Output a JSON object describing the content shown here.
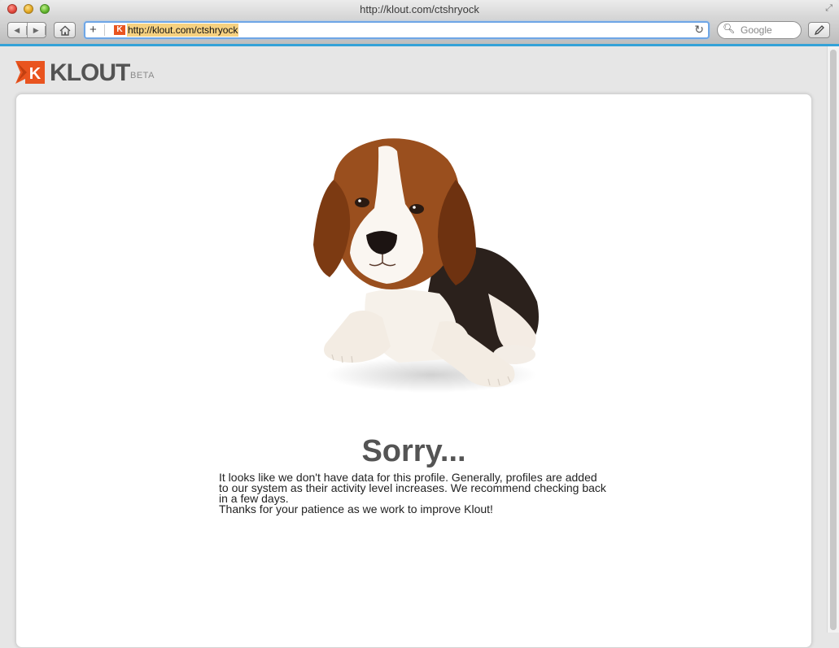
{
  "window": {
    "title": "http://klout.com/ctshryock"
  },
  "toolbar": {
    "url": "http://klout.com/ctshryock",
    "search_placeholder": "Google"
  },
  "brand": {
    "name": "KLOUT",
    "tag": "BETA",
    "mark_letter": "K"
  },
  "content": {
    "heading": "Sorry...",
    "paragraph": "It looks like we don't have data for this profile. Generally, profiles are added to our system as their activity level increases. We recommend checking back in a few days.",
    "thanks": "Thanks for your patience as we work to improve Klout!"
  },
  "colors": {
    "brand": "#e9541f",
    "heading": "#545454",
    "progress": "#34a2d8"
  }
}
